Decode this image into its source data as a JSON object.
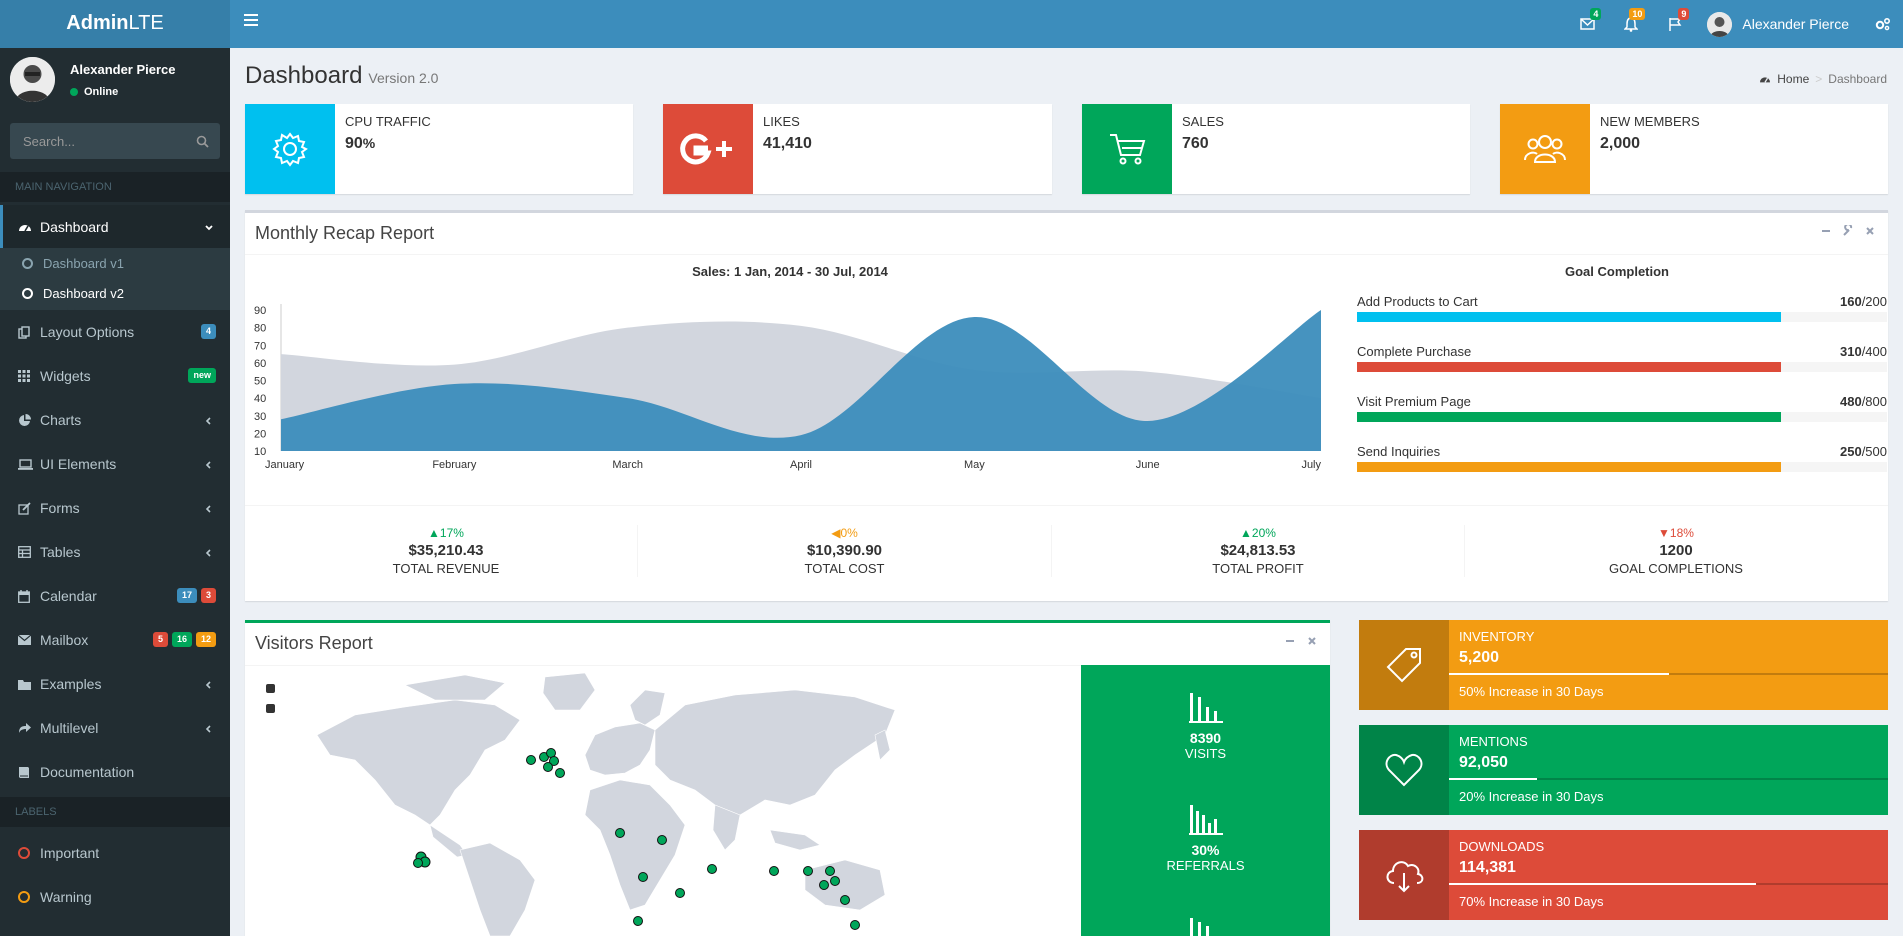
{
  "app": {
    "logo_bold": "Admin",
    "logo_rest": "LTE"
  },
  "navbar": {
    "user_name": "Alexander Pierce",
    "messages_count": "4",
    "notifications_count": "10",
    "tasks_count": "9",
    "colors": {
      "messages": "#00a65a",
      "notifications": "#f39c12",
      "tasks": "#dd4b39"
    }
  },
  "sidebar": {
    "user_name": "Alexander Pierce",
    "status": "Online",
    "search_placeholder": "Search...",
    "main_header": "MAIN NAVIGATION",
    "labels_header": "LABELS",
    "items": [
      {
        "label": "Dashboard",
        "icon": "dashboard-icon"
      },
      {
        "label": "Layout Options",
        "icon": "files-icon",
        "badge": "4"
      },
      {
        "label": "Widgets",
        "icon": "th-icon",
        "badge": "new"
      },
      {
        "label": "Charts",
        "icon": "pie-chart-icon"
      },
      {
        "label": "UI Elements",
        "icon": "laptop-icon"
      },
      {
        "label": "Forms",
        "icon": "edit-icon"
      },
      {
        "label": "Tables",
        "icon": "table-icon"
      },
      {
        "label": "Calendar",
        "icon": "calendar-icon",
        "badges": [
          "17",
          "3"
        ]
      },
      {
        "label": "Mailbox",
        "icon": "envelope-icon",
        "badges": [
          "5",
          "16",
          "12"
        ]
      },
      {
        "label": "Examples",
        "icon": "folder-icon"
      },
      {
        "label": "Multilevel",
        "icon": "share-icon"
      },
      {
        "label": "Documentation",
        "icon": "book-icon"
      }
    ],
    "submenu": [
      "Dashboard v1",
      "Dashboard v2"
    ],
    "labels": [
      {
        "label": "Important",
        "color": "#dd4b39"
      },
      {
        "label": "Warning",
        "color": "#f39c12"
      }
    ]
  },
  "page": {
    "title": "Dashboard",
    "subtitle": "Version 2.0",
    "breadcrumb": [
      "Home",
      "Dashboard"
    ]
  },
  "info_boxes": [
    {
      "label": "CPU TRAFFIC",
      "value": "90",
      "suffix": "%",
      "icon": "gear-icon",
      "color": "#00c0ef"
    },
    {
      "label": "LIKES",
      "value": "41,410",
      "icon": "google-plus-icon",
      "color": "#dd4b39"
    },
    {
      "label": "SALES",
      "value": "760",
      "icon": "shopping-cart-icon",
      "color": "#00a65a"
    },
    {
      "label": "NEW MEMBERS",
      "value": "2,000",
      "icon": "users-icon",
      "color": "#f39c12"
    }
  ],
  "monthly_report": {
    "title": "Monthly Recap Report",
    "goal_title": "Goal Completion",
    "goals": [
      {
        "label": "Add Products to Cart",
        "done": "160",
        "total": "/200",
        "fraction": 0.8,
        "color": "#00c0ef"
      },
      {
        "label": "Complete Purchase",
        "done": "310",
        "total": "/400",
        "fraction": 0.8,
        "color": "#dd4b39"
      },
      {
        "label": "Visit Premium Page",
        "done": "480",
        "total": "/800",
        "fraction": 0.8,
        "color": "#00a65a"
      },
      {
        "label": "Send Inquiries",
        "done": "250",
        "total": "/500",
        "fraction": 0.8,
        "color": "#f39c12"
      }
    ],
    "stats": [
      {
        "pct": "17%",
        "dir": "up",
        "amount": "$35,210.43",
        "label": "TOTAL REVENUE",
        "color": "#00a65a"
      },
      {
        "pct": "0%",
        "dir": "left",
        "amount": "$10,390.90",
        "label": "TOTAL COST",
        "color": "#f39c12"
      },
      {
        "pct": "20%",
        "dir": "up",
        "amount": "$24,813.53",
        "label": "TOTAL PROFIT",
        "color": "#00a65a"
      },
      {
        "pct": "18%",
        "dir": "down",
        "amount": "1200",
        "label": "GOAL COMPLETIONS",
        "color": "#dd4b39"
      }
    ]
  },
  "chart_data": {
    "type": "area",
    "title": "Sales: 1 Jan, 2014 - 30 Jul, 2014",
    "categories": [
      "January",
      "February",
      "March",
      "April",
      "May",
      "June",
      "July"
    ],
    "ylim": [
      10,
      90
    ],
    "yticks": [
      10,
      20,
      30,
      40,
      50,
      60,
      70,
      80,
      90
    ],
    "series": [
      {
        "values": [
          65,
          59,
          80,
          81,
          56,
          55,
          40
        ],
        "color": "#d2d6de"
      },
      {
        "values": [
          28,
          48,
          40,
          19,
          86,
          27,
          90
        ],
        "color": "#3c8dbc"
      }
    ]
  },
  "visitors": {
    "title": "Visitors Report",
    "stats": [
      {
        "value": "8390",
        "label": "VISITS"
      },
      {
        "value": "30%",
        "label": "REFERRALS"
      }
    ]
  },
  "small_boxes": [
    {
      "label": "INVENTORY",
      "value": "5,200",
      "desc": "50% Increase in 30 Days",
      "progress": 0.5,
      "color": "#f39c12",
      "icon": "tag-icon"
    },
    {
      "label": "MENTIONS",
      "value": "92,050",
      "desc": "20% Increase in 30 Days",
      "progress": 0.2,
      "color": "#00a65a",
      "icon": "heart-icon"
    },
    {
      "label": "DOWNLOADS",
      "value": "114,381",
      "desc": "70% Increase in 30 Days",
      "progress": 0.7,
      "color": "#dd4b39",
      "icon": "cloud-download-icon"
    }
  ]
}
